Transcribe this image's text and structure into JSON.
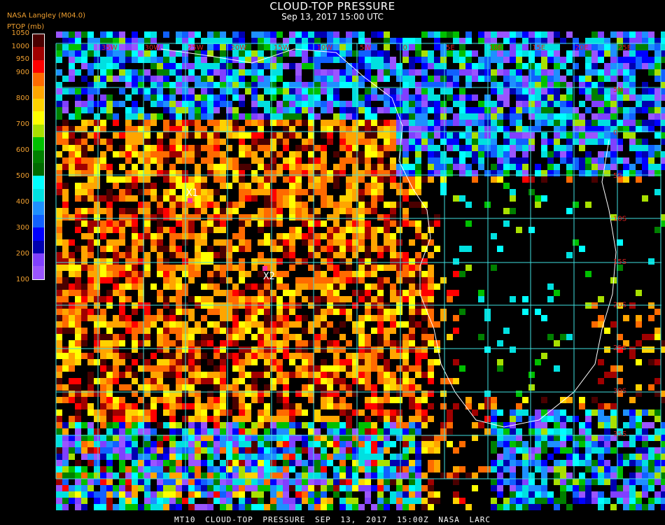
{
  "header": {
    "title": "CLOUD-TOP PRESSURE",
    "subtitle": "Sep 13, 2017 15:00 UTC",
    "brand": "NASA Langley (M04.0)",
    "units_label": "PTOP (mb)"
  },
  "legend": {
    "ticks": [
      "1050",
      "1000",
      "950",
      "900",
      "850",
      "800",
      "750",
      "700",
      "650",
      "600",
      "550",
      "500",
      "450",
      "400",
      "350",
      "300",
      "250",
      "200",
      "150",
      "100"
    ],
    "visible_labels": [
      "1050",
      "1000",
      "950",
      "900",
      "800",
      "700",
      "600",
      "500",
      "400",
      "300",
      "200",
      "100"
    ],
    "bands": [
      {
        "range": "1000-1050",
        "color": "#4a0000"
      },
      {
        "range": "950-1000",
        "color": "#a00000"
      },
      {
        "range": "900-950",
        "color": "#ff0000"
      },
      {
        "range": "850-900",
        "color": "#ff6a00"
      },
      {
        "range": "800-850",
        "color": "#ffa500"
      },
      {
        "range": "750-800",
        "color": "#ffd200"
      },
      {
        "range": "700-750",
        "color": "#ffff00"
      },
      {
        "range": "650-700",
        "color": "#a8e000"
      },
      {
        "range": "600-650",
        "color": "#00c000"
      },
      {
        "range": "550-600",
        "color": "#008000"
      },
      {
        "range": "500-550",
        "color": "#006a00"
      },
      {
        "range": "450-500",
        "color": "#00ffff"
      },
      {
        "range": "400-450",
        "color": "#00e0e0"
      },
      {
        "range": "350-400",
        "color": "#1e90ff"
      },
      {
        "range": "300-350",
        "color": "#1060ff"
      },
      {
        "range": "250-300",
        "color": "#0000ff"
      },
      {
        "range": "200-250",
        "color": "#0000b0"
      },
      {
        "range": "150-200",
        "color": "#8040ff"
      },
      {
        "range": "100-150",
        "color": "#9a55ff"
      }
    ]
  },
  "map": {
    "grid_color": "#40e0e0",
    "coastline_color": "#ffffff",
    "background": "#000000",
    "lon_labels": [
      "35W",
      "30W",
      "25W",
      "20W",
      "15W",
      "10W",
      "5W",
      "0",
      "5E",
      "10E",
      "15E",
      "20E",
      "25E",
      "30E",
      "35E"
    ],
    "lat_labels": [
      "5N",
      "0",
      "5S",
      "10S",
      "15S",
      "20S",
      "25S",
      "30S",
      "35S"
    ],
    "markers": [
      {
        "label": "X1",
        "color": "#ff3399"
      },
      {
        "label": "X2",
        "color": "#ff3399"
      }
    ]
  },
  "footer": {
    "text": "MT10  CLOUD-TOP PRESSURE  SEP 13, 2017 15:00Z  NASA LARC"
  }
}
